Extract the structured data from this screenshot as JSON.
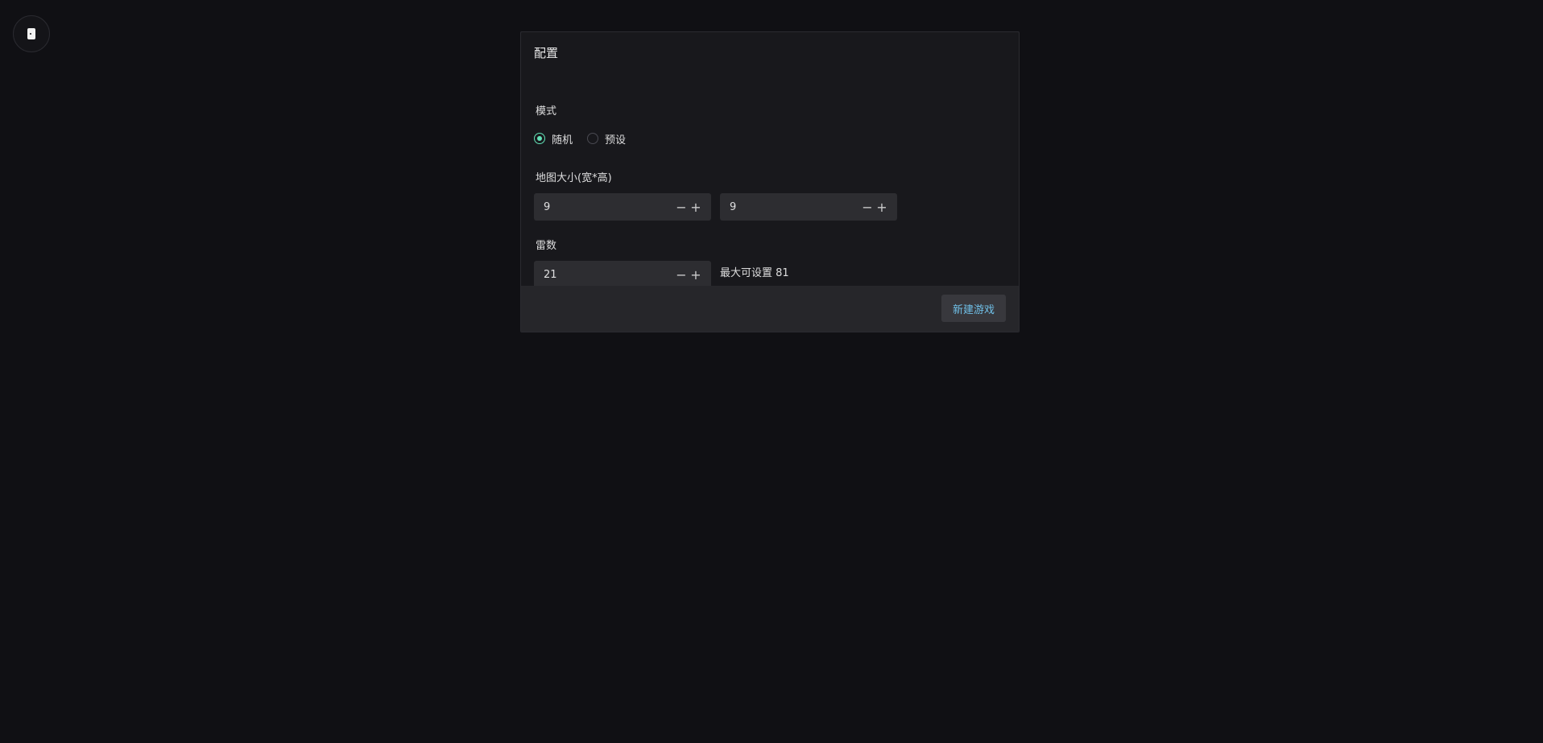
{
  "theme_toggle": {
    "icon": "moon-icon"
  },
  "config": {
    "title": "配置",
    "mode": {
      "label": "模式",
      "options": [
        {
          "label": "随机",
          "checked": true
        },
        {
          "label": "预设",
          "checked": false
        }
      ]
    },
    "map_size": {
      "label": "地图大小(宽*高)",
      "width": "9",
      "height": "9"
    },
    "mines": {
      "label": "雷数",
      "value": "21",
      "hint": "最大可设置 81"
    },
    "stepper": {
      "minus": "−",
      "plus": "+"
    },
    "new_game_label": "新建游戏"
  },
  "colors": {
    "accent_green": "#63e2b7",
    "accent_blue": "#70c0e8",
    "background": "#101014"
  }
}
